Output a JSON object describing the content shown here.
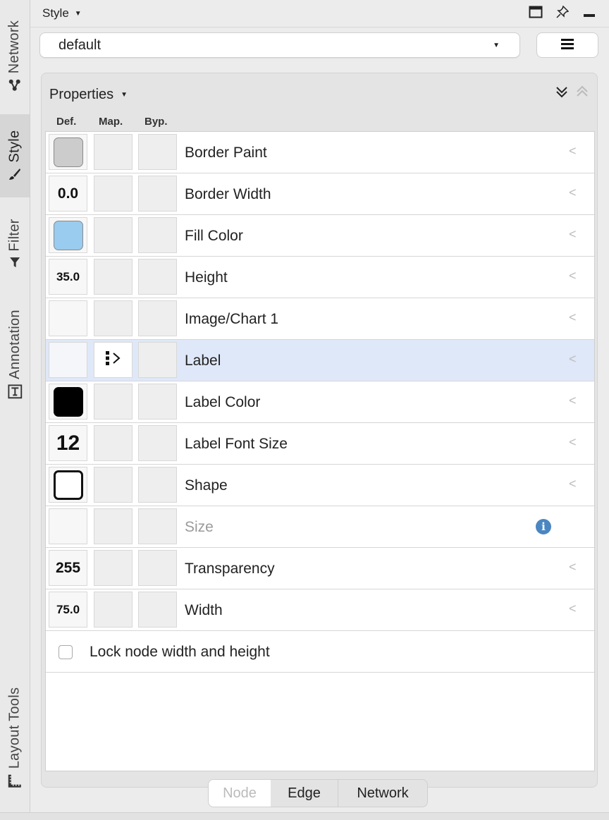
{
  "side_tabs": [
    {
      "label": "Network",
      "icon": "network-icon"
    },
    {
      "label": "Style",
      "icon": "brush-icon"
    },
    {
      "label": "Filter",
      "icon": "funnel-icon"
    },
    {
      "label": "Annotation",
      "icon": "text-box-icon"
    },
    {
      "label": "Layout Tools",
      "icon": "ruler-icon"
    }
  ],
  "header": {
    "title": "Style",
    "icons": [
      "maximize-icon",
      "pin-icon",
      "minimize-icon"
    ]
  },
  "style_select": {
    "value": "default"
  },
  "menu_button": {
    "icon": "hamburger-menu-icon"
  },
  "properties": {
    "title": "Properties",
    "columns": [
      "Def.",
      "Map.",
      "Byp."
    ],
    "rows": [
      {
        "label": "Border Paint",
        "def_type": "color",
        "def_color": "#cccccc",
        "selected": false
      },
      {
        "label": "Border Width",
        "def_type": "text",
        "def_value": "0.0",
        "selected": false
      },
      {
        "label": "Fill Color",
        "def_type": "color",
        "def_color": "#99ccee",
        "selected": false
      },
      {
        "label": "Height",
        "def_type": "text",
        "def_value": "35.0",
        "selected": false
      },
      {
        "label": "Image/Chart 1",
        "def_type": "empty",
        "selected": false
      },
      {
        "label": "Label",
        "def_type": "empty",
        "map_icon": "passthrough-mapping-icon",
        "selected": true
      },
      {
        "label": "Label Color",
        "def_type": "color",
        "def_color": "#000000",
        "selected": false
      },
      {
        "label": "Label Font Size",
        "def_type": "text",
        "def_value": "12",
        "selected": false
      },
      {
        "label": "Shape",
        "def_type": "shape",
        "selected": false
      },
      {
        "label": "Size",
        "def_type": "empty",
        "disabled": true,
        "selected": false
      },
      {
        "label": "Transparency",
        "def_type": "text",
        "def_value": "255",
        "selected": false
      },
      {
        "label": "Width",
        "def_type": "text",
        "def_value": "75.0",
        "selected": false
      }
    ],
    "lock_label": "Lock node width and height",
    "lock_checked": false
  },
  "bottom_tabs": {
    "node": "Node",
    "edge": "Edge",
    "network": "Network",
    "selected": "Node"
  }
}
